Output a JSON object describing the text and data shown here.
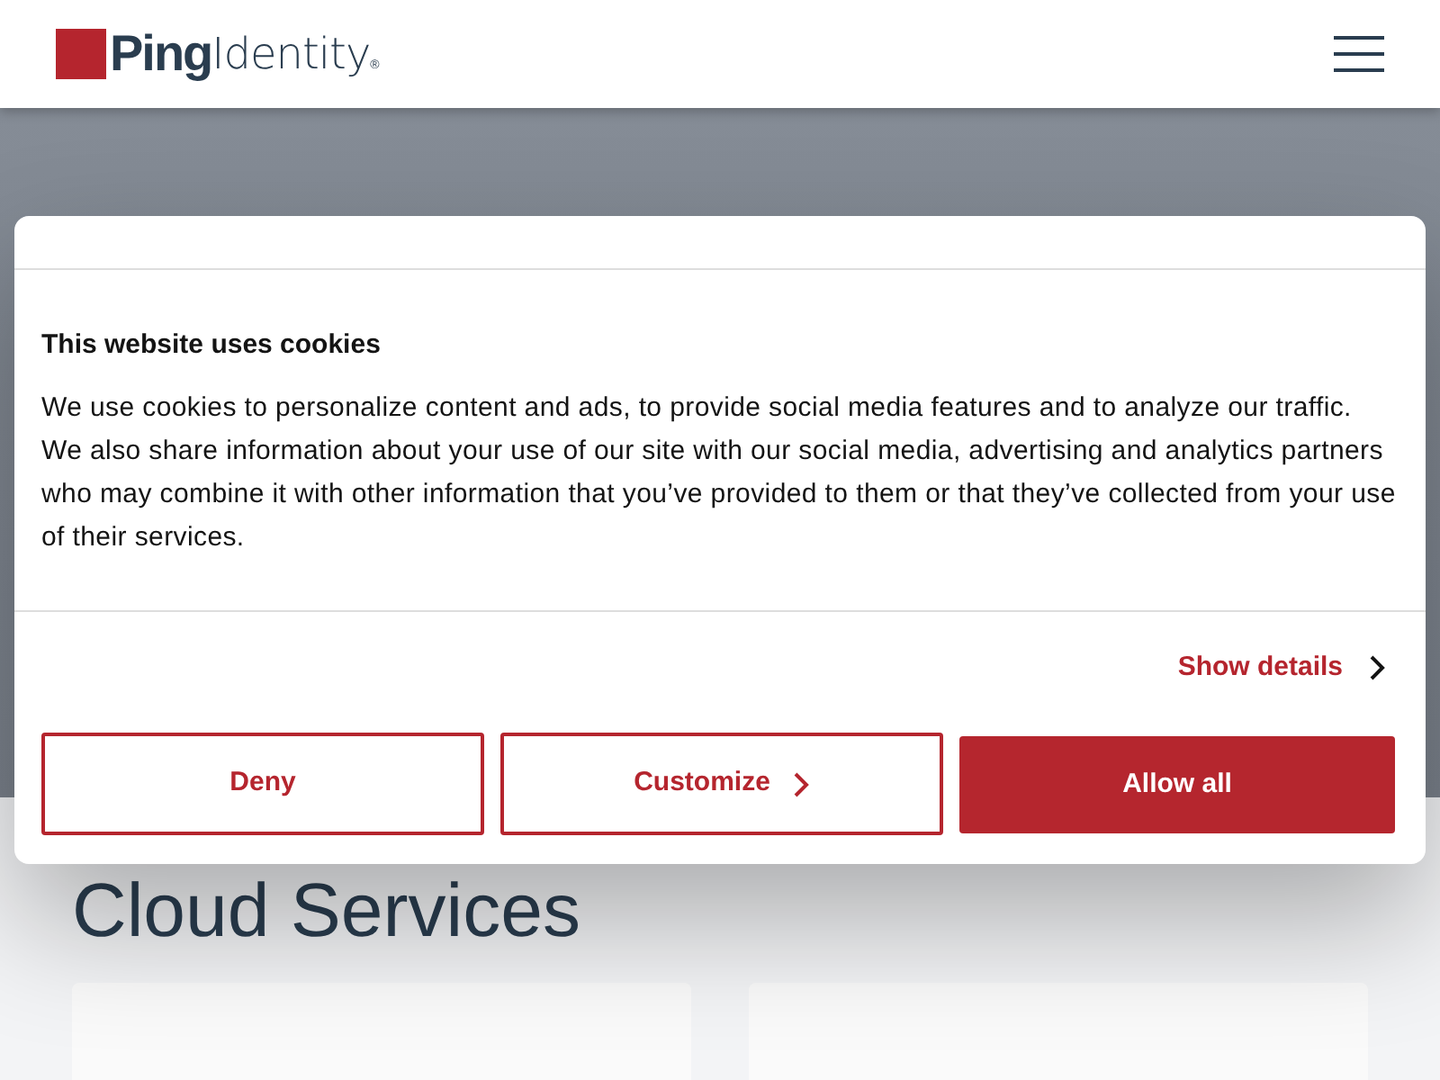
{
  "header": {
    "logo": {
      "bold": "Ping",
      "light": "Identity",
      "mark": "®"
    }
  },
  "section": {
    "title": "Cloud Services"
  },
  "cookie_dialog": {
    "title": "This website uses cookies",
    "body": "We use cookies to personalize content and ads, to provide social media features and to analyze our traffic. We also share information about your use of our site with our social media, advertising and analytics partners who may combine it with other information that you’ve provided to them or that they’ve collected from your use of their services.",
    "details_link": "Show details",
    "buttons": [
      {
        "label": "Deny",
        "kind": "outline"
      },
      {
        "label": "Customize",
        "kind": "outline-chevron"
      },
      {
        "label": "Allow all",
        "kind": "filled"
      }
    ]
  }
}
